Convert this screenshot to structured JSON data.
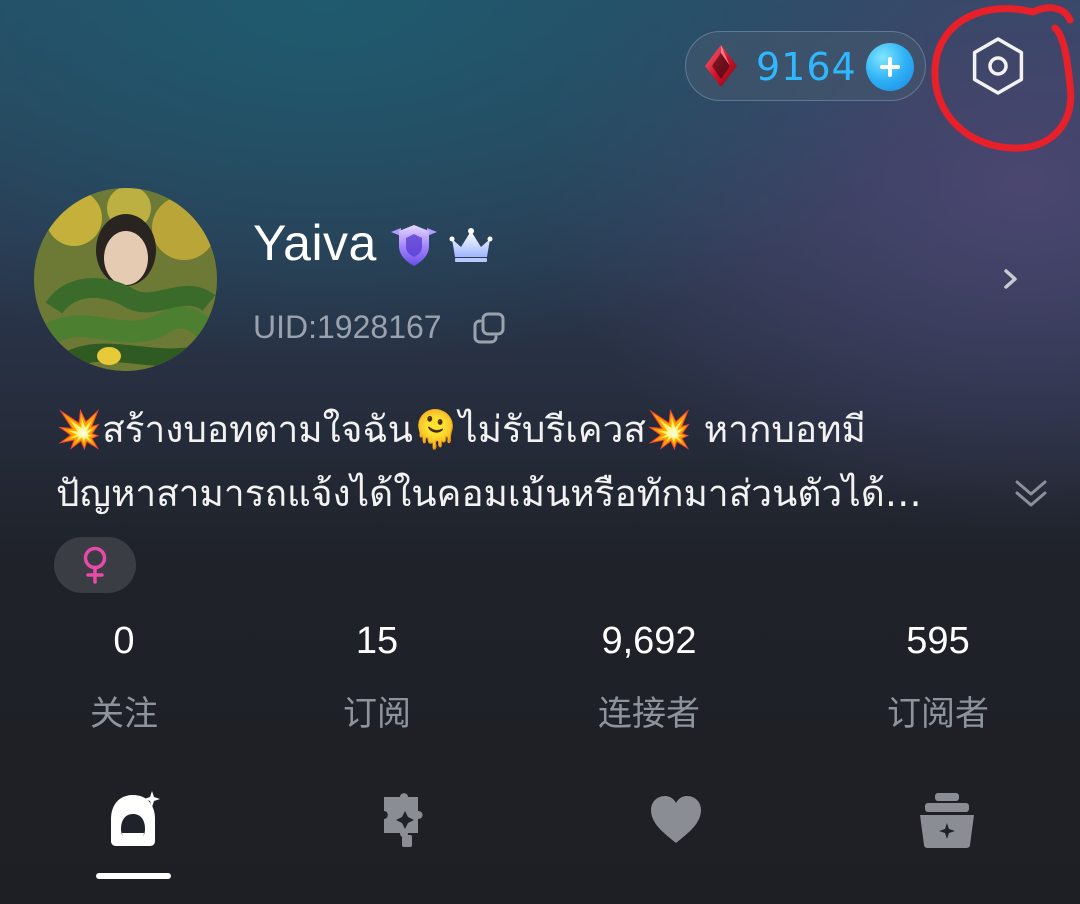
{
  "header": {
    "gem_count": "9164",
    "gem_icon": "red-diamond-icon",
    "add_icon": "plus-icon",
    "settings_icon": "hexagon-settings-icon"
  },
  "profile": {
    "username": "Yaiva",
    "uid": "UID:1928167",
    "badges": [
      "purple-shield-badge-icon",
      "crown-badge-icon"
    ],
    "bio_lines": [
      "💥สร้างบอทตามใจฉัน🫠ไม่รับรีเควส💥 หากบอทมี",
      "ปัญหาสามารถแจ้งได้ในคอมเม้นหรือทักมาส่วนตัวได้…"
    ],
    "gender_icon": "female-symbol-icon"
  },
  "stats": [
    {
      "value": "0",
      "label": "关注"
    },
    {
      "value": "15",
      "label": "订阅"
    },
    {
      "value": "9,692",
      "label": "连接者"
    },
    {
      "value": "595",
      "label": "订阅者"
    }
  ],
  "tabs": [
    {
      "icon": "character-icon",
      "active": true
    },
    {
      "icon": "puzzle-icon",
      "active": false
    },
    {
      "icon": "heart-icon",
      "active": false
    },
    {
      "icon": "treasure-box-icon",
      "active": false
    }
  ],
  "colors": {
    "gem_text": "#30b8ff",
    "annotation": "#e8202a",
    "female": "#e94aa8",
    "badge_purple": "#9b7bff"
  }
}
